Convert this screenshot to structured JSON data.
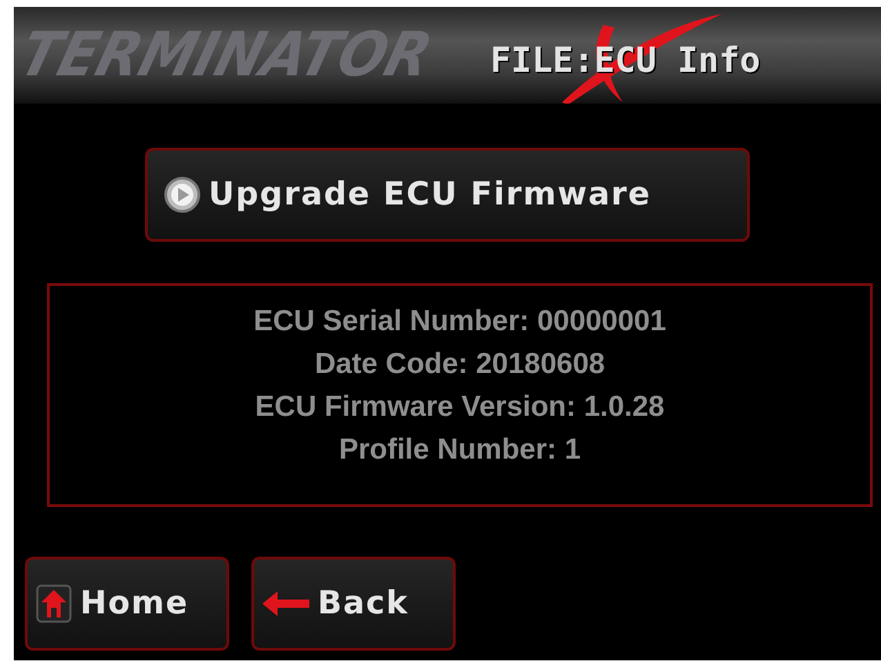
{
  "header": {
    "logo": "TERMINATOR",
    "title": "FILE:ECU Info"
  },
  "upgrade_button": {
    "label": "Upgrade ECU Firmware"
  },
  "info_lines": [
    "ECU Serial Number: 00000001",
    "Date Code: 20180608",
    "ECU Firmware Version: 1.0.28",
    "Profile Number: 1"
  ],
  "nav_buttons": [
    {
      "kind": "home",
      "label": "Home"
    },
    {
      "kind": "back",
      "label": "Back"
    }
  ]
}
